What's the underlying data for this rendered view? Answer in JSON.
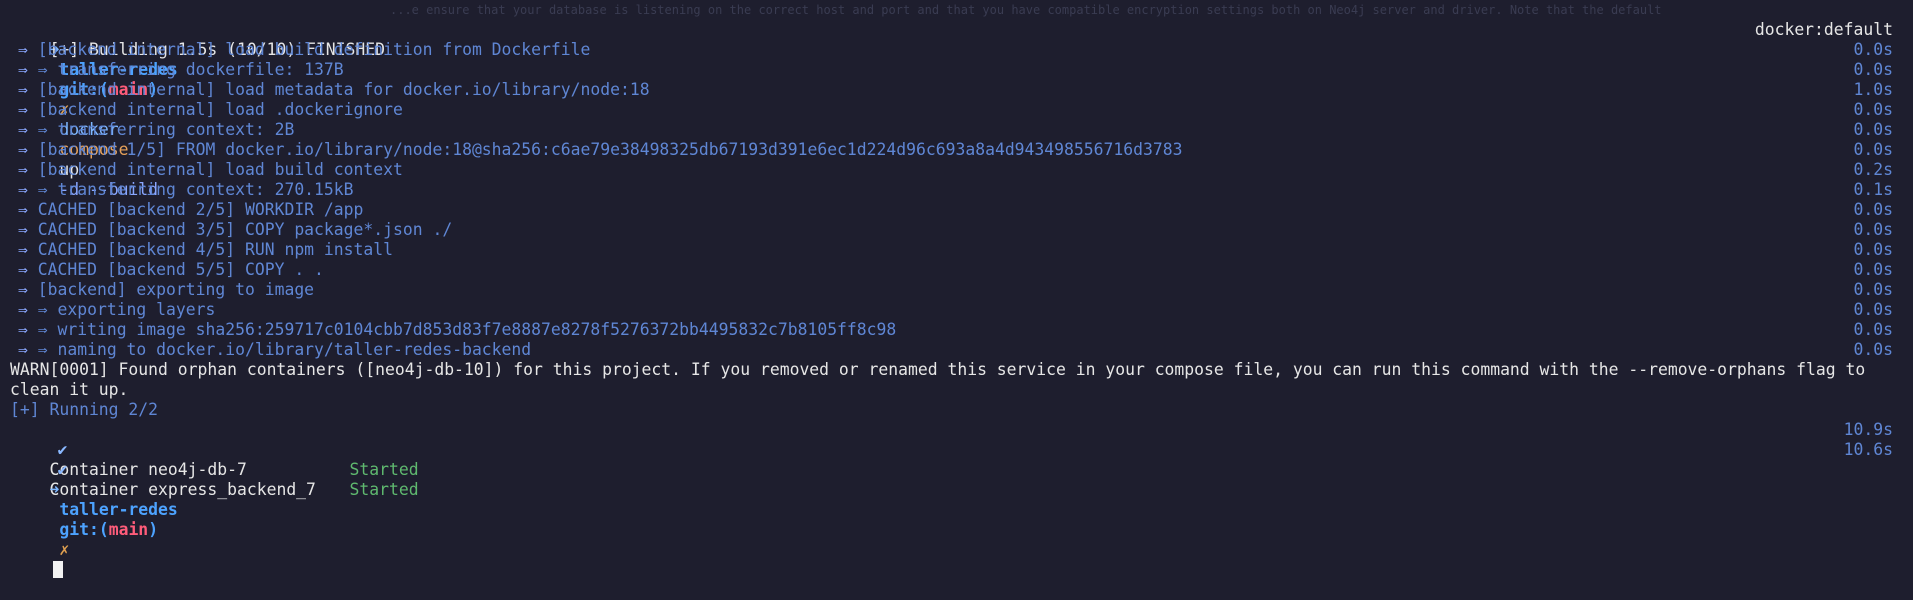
{
  "prompt1": {
    "arrow": "➜",
    "dir": "taller-redes",
    "git_prefix": "git:(",
    "branch": "main",
    "git_suffix": ")",
    "dirty": "✗",
    "cmd": "docker",
    "sub": "compose",
    "arg": "up",
    "flags": "-d --build"
  },
  "ghost_text": "...e ensure that your database is listening on the correct host and port and that you have compatible encryption settings both on Neo4j server and driver. Note that the default",
  "build": {
    "header": "[+] Building 1.5s (10/10) FINISHED",
    "context": "docker:default",
    "steps": [
      {
        "arrow": "⇒",
        "text": "[backend internal] load build definition from Dockerfile",
        "time": "0.0s"
      },
      {
        "arrow": "⇒",
        "text": "⇒ transferring dockerfile: 137B",
        "time": "0.0s"
      },
      {
        "arrow": "⇒",
        "text": "[backend internal] load metadata for docker.io/library/node:18",
        "time": "1.0s"
      },
      {
        "arrow": "⇒",
        "text": "[backend internal] load .dockerignore",
        "time": "0.0s"
      },
      {
        "arrow": "⇒",
        "text": "⇒ transferring context: 2B",
        "time": "0.0s"
      },
      {
        "arrow": "⇒",
        "text": "[backend 1/5] FROM docker.io/library/node:18@sha256:c6ae79e38498325db67193d391e6ec1d224d96c693a8a4d943498556716d3783",
        "time": "0.0s"
      },
      {
        "arrow": "⇒",
        "text": "[backend internal] load build context",
        "time": "0.2s"
      },
      {
        "arrow": "⇒",
        "text": "⇒ transferring context: 270.15kB",
        "time": "0.1s"
      },
      {
        "arrow": "⇒",
        "text": "CACHED [backend 2/5] WORKDIR /app",
        "time": "0.0s"
      },
      {
        "arrow": "⇒",
        "text": "CACHED [backend 3/5] COPY package*.json ./",
        "time": "0.0s"
      },
      {
        "arrow": "⇒",
        "text": "CACHED [backend 4/5] RUN npm install",
        "time": "0.0s"
      },
      {
        "arrow": "⇒",
        "text": "CACHED [backend 5/5] COPY . .",
        "time": "0.0s"
      },
      {
        "arrow": "⇒",
        "text": "[backend] exporting to image",
        "time": "0.0s"
      },
      {
        "arrow": "⇒",
        "text": "⇒ exporting layers",
        "time": "0.0s"
      },
      {
        "arrow": "⇒",
        "text": "⇒ writing image sha256:259717c0104cbb7d853d83f7e8887e8278f5276372bb4495832c7b8105ff8c98",
        "time": "0.0s"
      },
      {
        "arrow": "⇒",
        "text": "⇒ naming to docker.io/library/taller-redes-backend",
        "time": "0.0s"
      }
    ]
  },
  "warn": {
    "line1": "WARN[0001] Found orphan containers ([neo4j-db-10]) for this project. If you removed or renamed this service in your compose file, you can run this command with the --remove-orphans flag to",
    "line2": "clean it up."
  },
  "running": {
    "header": "[+] Running 2/2",
    "containers": [
      {
        "check": "✔",
        "name": "Container neo4j-db-7",
        "status": "Started",
        "time": "10.9s"
      },
      {
        "check": "✔",
        "name": "Container express_backend_7",
        "status": "Started",
        "time": "10.6s"
      }
    ]
  },
  "prompt2": {
    "arrow": "➜",
    "dir": "taller-redes",
    "git_prefix": "git:(",
    "branch": "main",
    "git_suffix": ")",
    "dirty": "✗"
  },
  "colors": {
    "background": "#1e1e2e",
    "build_step": "#5f86d4",
    "branch": "#ff5c7a",
    "started": "#5fb96f"
  }
}
